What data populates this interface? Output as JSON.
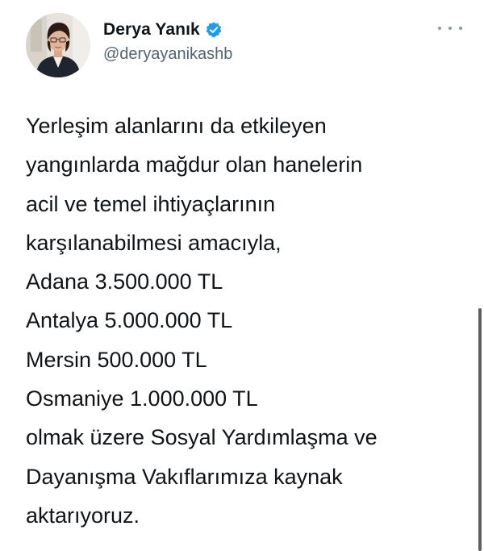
{
  "author": {
    "display_name": "Derya Yanık",
    "handle": "@deryayanikashb",
    "verified": true,
    "avatar_icon": "profile-photo"
  },
  "more_menu_icon": "more-dots-icon",
  "tweet": {
    "lines": [
      "Yerleşim alanlarını da etkileyen",
      "yangınlarda mağdur olan hanelerin",
      "acil ve temel ihtiyaçlarının",
      "karşılanabilmesi amacıyla,",
      "Adana 3.500.000 TL",
      "Antalya 5.000.000 TL",
      "Mersin 500.000 TL",
      "Osmaniye 1.000.000 TL",
      "olmak üzere Sosyal Yardımlaşma ve",
      "Dayanışma Vakıflarımıza kaynak",
      "aktarıyoruz."
    ]
  },
  "colors": {
    "verified_badge": "#1d9bf0",
    "text": "#0f1419",
    "secondary_text": "#536471"
  }
}
